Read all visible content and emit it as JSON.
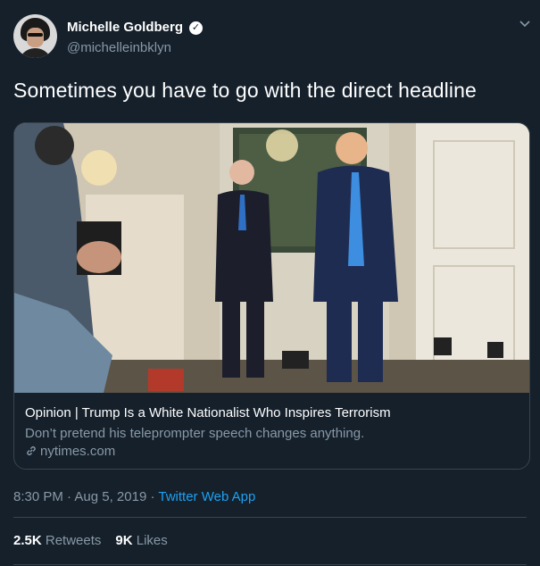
{
  "author": {
    "name": "Michelle Goldberg",
    "handle": "@michelleinbklyn",
    "verified_icon": "verified-badge"
  },
  "tweet": {
    "text": "Sometimes you have to go with the direct headline"
  },
  "card": {
    "title": "Opinion | Trump Is a White Nationalist Who Inspires Terrorism",
    "description": "Don’t pretend his teleprompter speech changes anything.",
    "domain": "nytimes.com"
  },
  "meta": {
    "time": "8:30 PM",
    "date": "Aug 5, 2019",
    "separator": "·",
    "source": "Twitter Web App"
  },
  "stats": {
    "retweets_count": "2.5K",
    "retweets_label": "Retweets",
    "likes_count": "9K",
    "likes_label": "Likes"
  },
  "colors": {
    "background": "#15202b",
    "secondary_text": "#8899a6",
    "accent": "#1da1f2",
    "border": "#38444d"
  }
}
